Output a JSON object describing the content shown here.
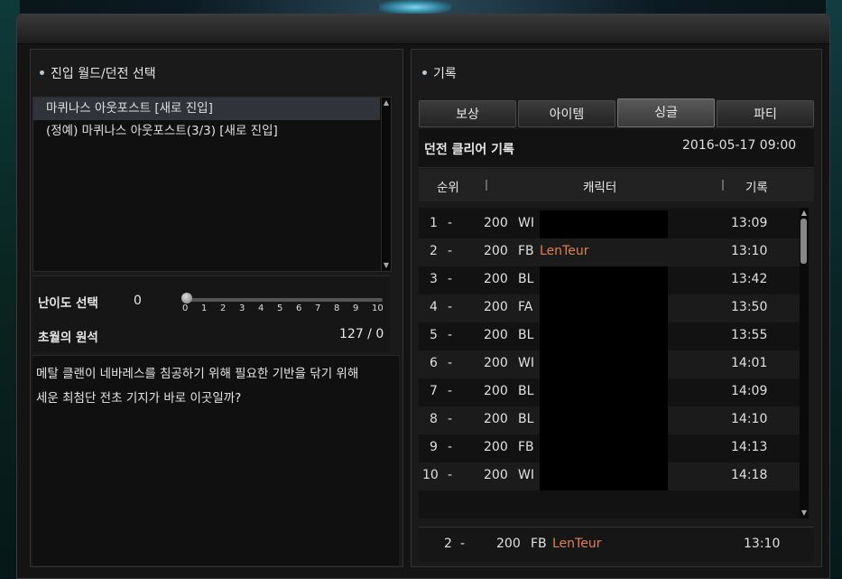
{
  "left": {
    "section_title": "진입 월드/던전 선택",
    "dungeons": [
      {
        "label": "마퀴나스 아웃포스트 [새로 진입]",
        "selected": true
      },
      {
        "label": "(정예) 마퀴나스 아웃포스트(3/3) [새로 진입]",
        "selected": false
      }
    ],
    "difficulty_label": "난이도 선택",
    "difficulty_value": "0",
    "slider_ticks": [
      "0",
      "1",
      "2",
      "3",
      "4",
      "5",
      "6",
      "7",
      "8",
      "9",
      "10"
    ],
    "slider_level": 0,
    "stone_label": "초월의 원석",
    "stone_value": "127 / 0",
    "description_lines": [
      "메탈 클랜이 네바레스를 침공하기 위해 필요한 기반을 닦기 위해",
      "세운 최첨단 전초 기지가 바로 이곳일까?"
    ]
  },
  "right": {
    "section_title": "기록",
    "tabs": [
      "보상",
      "아이템",
      "싱글",
      "파티"
    ],
    "active_tab": "싱글",
    "record_title": "던전 클리어 기록",
    "record_date": "2016-05-17 09:00",
    "columns": {
      "rank": "순위",
      "character": "캐릭터",
      "record": "기록"
    },
    "rows": [
      {
        "rank": "1",
        "dash": "-",
        "level": "200",
        "cls": "WI",
        "name": "",
        "time": "13:09"
      },
      {
        "rank": "2",
        "dash": "-",
        "level": "200",
        "cls": "FB",
        "name": "LenTeur",
        "time": "13:10"
      },
      {
        "rank": "3",
        "dash": "-",
        "level": "200",
        "cls": "BL",
        "name": "",
        "time": "13:42"
      },
      {
        "rank": "4",
        "dash": "-",
        "level": "200",
        "cls": "FA",
        "name": "",
        "time": "13:50"
      },
      {
        "rank": "5",
        "dash": "-",
        "level": "200",
        "cls": "BL",
        "name": "",
        "time": "13:55"
      },
      {
        "rank": "6",
        "dash": "-",
        "level": "200",
        "cls": "WI",
        "name": "",
        "time": "14:01"
      },
      {
        "rank": "7",
        "dash": "-",
        "level": "200",
        "cls": "BL",
        "name": "",
        "time": "14:09"
      },
      {
        "rank": "8",
        "dash": "-",
        "level": "200",
        "cls": "BL",
        "name": "",
        "time": "14:10"
      },
      {
        "rank": "9",
        "dash": "-",
        "level": "200",
        "cls": "FB",
        "name": "",
        "time": "14:13"
      },
      {
        "rank": "10",
        "dash": "-",
        "level": "200",
        "cls": "WI",
        "name": "",
        "time": "14:18"
      }
    ],
    "my_record": {
      "rank": "2",
      "dash": "-",
      "level": "200",
      "cls": "FB",
      "name": "LenTeur",
      "time": "13:10"
    }
  },
  "icons": {
    "scroll_up": "▲",
    "scroll_down": "▼"
  },
  "colors": {
    "highlight_name": "#e08050",
    "selected_row": "#30343a"
  }
}
